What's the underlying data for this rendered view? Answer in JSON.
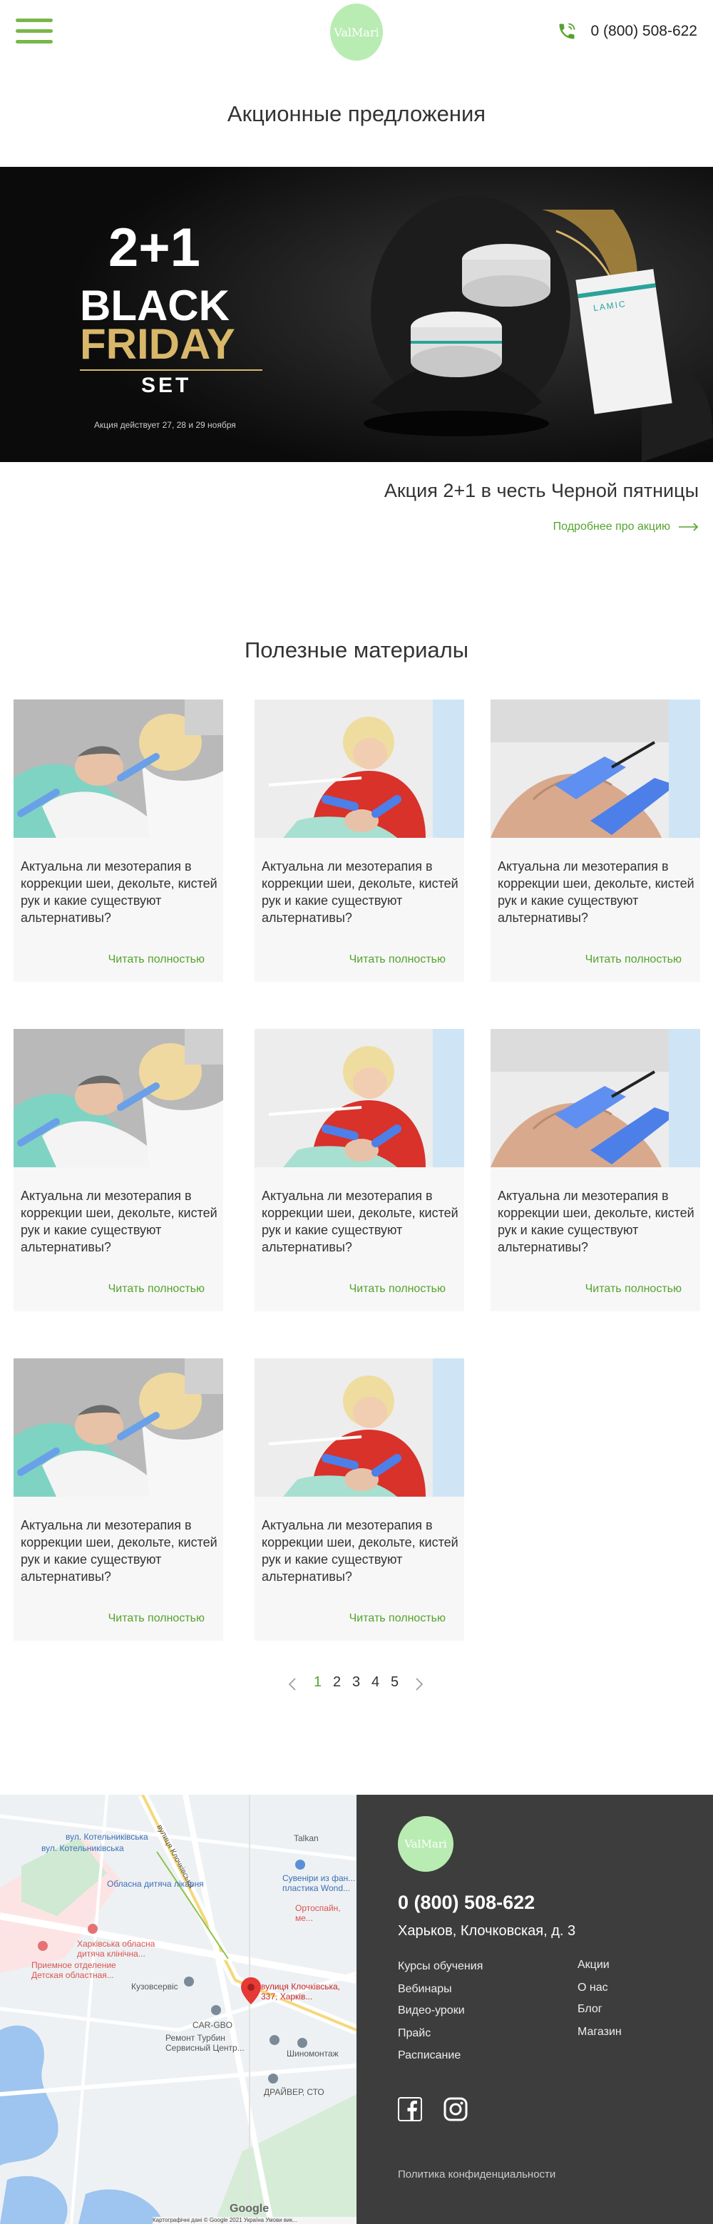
{
  "header": {
    "logo": "ValMari",
    "phone": "0 (800) 508-622"
  },
  "promo": {
    "section_title": "Акционные предложения",
    "banner": {
      "big": "2+1",
      "line1": "BLACK",
      "line2": "FRIDAY",
      "line3": "SET",
      "note": "Акция действует 27, 28 и 29 ноября",
      "brand": "LAMIC"
    },
    "title": "Акция 2+1 в честь Черной пятницы",
    "link": "Подробнее про акцию"
  },
  "materials": {
    "section_title": "Полезные материалы",
    "cards": [
      {
        "title": "Актуальна ли мезотерапия в коррекции шеи, декольте, кистей рук и какие существуют альтернативы?",
        "read": "Читать полностью",
        "photo": "photo-a"
      },
      {
        "title": "Актуальна ли мезотерапия в коррекции шеи, декольте, кистей рук и какие существуют альтернативы?",
        "read": "Читать полностью",
        "photo": "photo-b"
      },
      {
        "title": "Актуальна ли мезотерапия в коррекции шеи, декольте, кистей рук и какие существуют альтернативы?",
        "read": "Читать полностью",
        "photo": "photo-c"
      },
      {
        "title": "Актуальна ли мезотерапия в коррекции шеи, декольте, кистей рук и какие существуют альтернативы?",
        "read": "Читать полностью",
        "photo": "photo-a"
      },
      {
        "title": "Актуальна ли мезотерапия в коррекции шеи, декольте, кистей рук и какие существуют альтернативы?",
        "read": "Читать полностью",
        "photo": "photo-b"
      },
      {
        "title": "Актуальна ли мезотерапия в коррекции шеи, декольте, кистей рук и какие существуют альтернативы?",
        "read": "Читать полностью",
        "photo": "photo-c"
      },
      {
        "title": "Актуальна ли мезотерапия в коррекции шеи, декольте, кистей рук и какие существуют альтернативы?",
        "read": "Читать полностью",
        "photo": "photo-a"
      },
      {
        "title": "Актуальна ли мезотерапия в коррекции шеи, декольте, кистей рук и какие существуют альтернативы?",
        "read": "Читать полностью",
        "photo": "photo-b"
      }
    ]
  },
  "pagination": {
    "pages": [
      "1",
      "2",
      "3",
      "4",
      "5"
    ],
    "current": "1",
    "prev_icon": "chevron-left-icon",
    "next_icon": "chevron-right-icon"
  },
  "map": {
    "labels": [
      "вул. Котельниківська",
      "вул. Котельниківська",
      "Обласна дитяча лікарня",
      "Харківська обласна дитяча клінічна...",
      "Приемное отделение Детская областная...",
      "Кузовсервіс",
      "CAR-GBO",
      "Ремонт Турбин Сервисный Центр...",
      "вулиця Клочківська, 337, Харків...",
      "Шиномонтаж",
      "ДРАЙВЕР, СТО",
      "Talkan",
      "Сувеніри из фан... пластика Wond...",
      "Ортоспайн, ме...",
      "вулиця Клочківська"
    ],
    "attribution": "Картографічні дані © Google  2021   Україна   Умови вик...",
    "google": "Google"
  },
  "footer": {
    "logo": "ValMari",
    "phone": "0 (800) 508-622",
    "address": "Харьков, Клочковская, д. 3",
    "menu_left": [
      "Курсы обучения",
      "Вебинары",
      "Видео-уроки",
      "Прайс",
      "Расписание"
    ],
    "menu_right": [
      "Акции",
      "О нас",
      "Блог",
      "Магазин"
    ],
    "social": [
      "facebook-icon",
      "instagram-icon"
    ],
    "policy": "Политика конфиденциальности"
  },
  "colors": {
    "accent": "#55a32e",
    "logo_bg": "#b9ecb3",
    "footer_bg": "#3d3d3d"
  }
}
